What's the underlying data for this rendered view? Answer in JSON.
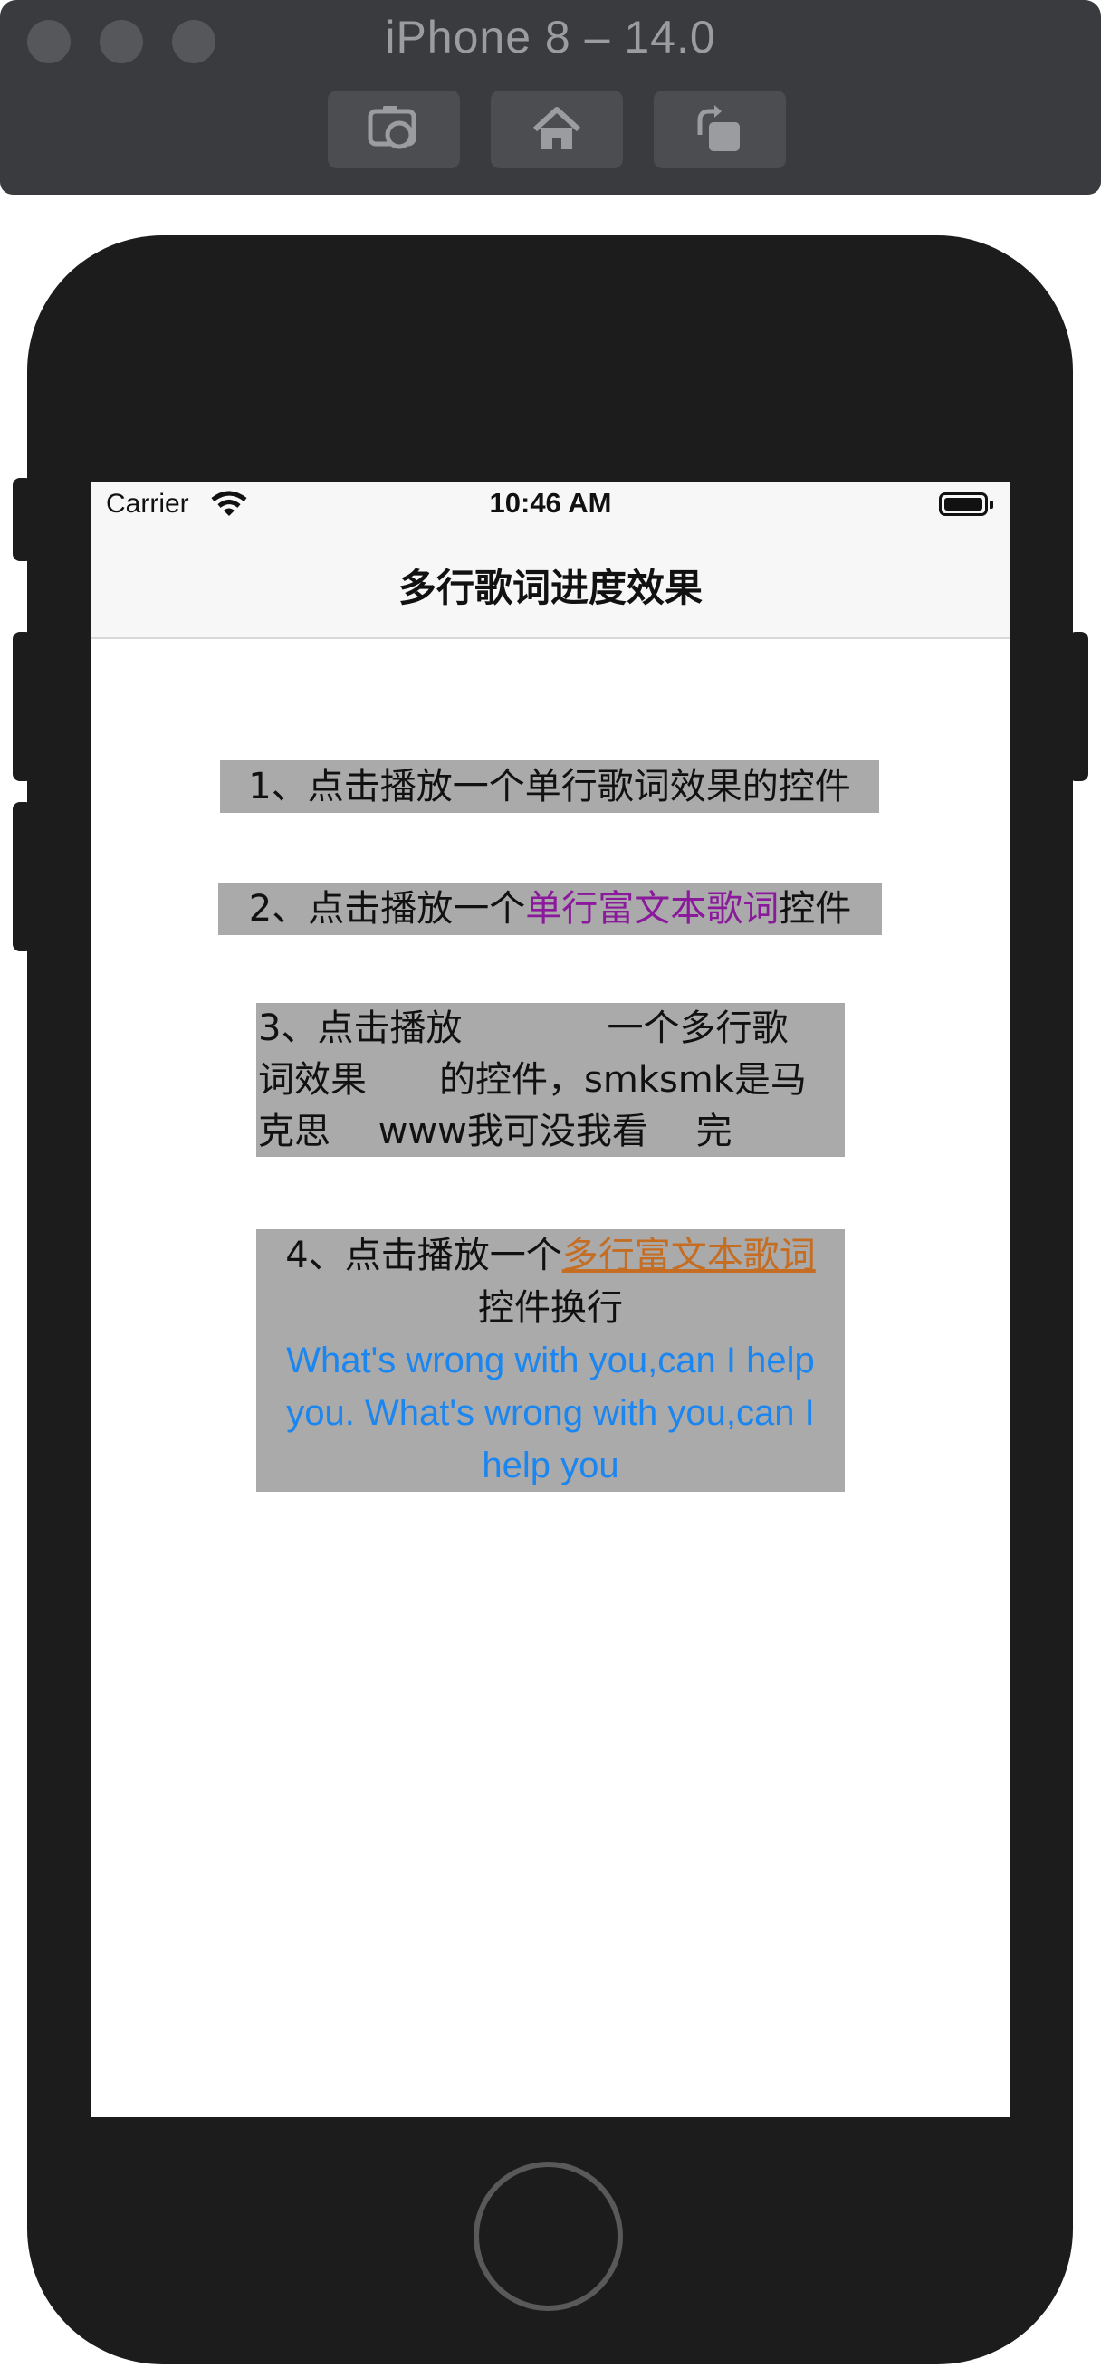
{
  "simulator": {
    "title": "iPhone 8 – 14.0",
    "toolbar": {
      "screenshot_icon": "camera-icon",
      "home_icon": "home-icon",
      "rotate_icon": "rotate-icon"
    }
  },
  "status_bar": {
    "carrier": "Carrier",
    "time": "10:46 AM"
  },
  "nav": {
    "title": "多行歌词进度效果"
  },
  "items": [
    {
      "text": "1、点击播放一个单行歌词效果的控件"
    },
    {
      "prefix": "2、点击播放一个",
      "highlight": "单行富文本歌词",
      "suffix": "控件"
    },
    {
      "lines": [
        "3、点击播放　　　　一个多行歌",
        "词效果　　的控件，smksmk是马",
        "克思　 www我可没我看　 完"
      ]
    },
    {
      "prefix": "4、点击播放一个",
      "highlight": "多行富文本歌词",
      "line2": "控件换行",
      "english_lines": [
        "What's wrong with you,can I help",
        "you. What's wrong with you,can I",
        "help you"
      ]
    }
  ],
  "colors": {
    "label_bg": "#aaaaaa",
    "purple": "#8a1a9b",
    "orange": "#c46d23",
    "blue": "#1b86f0"
  }
}
